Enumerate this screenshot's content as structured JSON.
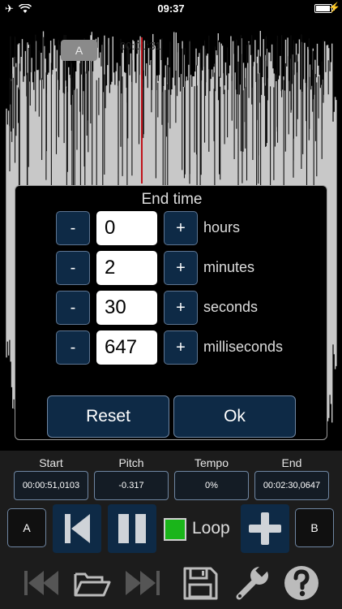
{
  "status_bar": {
    "time": "09:37"
  },
  "waveform": {
    "marker_a_label": "A",
    "playhead_time": "00:01:31"
  },
  "dialog": {
    "title": "End time",
    "minus_label": "-",
    "plus_label": "+",
    "rows": [
      {
        "value": "0",
        "unit": "hours"
      },
      {
        "value": "2",
        "unit": "minutes"
      },
      {
        "value": "30",
        "unit": "seconds"
      },
      {
        "value": "647",
        "unit": "milliseconds"
      }
    ],
    "reset_label": "Reset",
    "ok_label": "Ok"
  },
  "params": {
    "start": {
      "label": "Start",
      "value": "00:00:51,0103"
    },
    "pitch": {
      "label": "Pitch",
      "value": "-0.317"
    },
    "tempo": {
      "label": "Tempo",
      "value": "0%"
    },
    "end": {
      "label": "End",
      "value": "00:02:30,0647"
    }
  },
  "controls": {
    "a_label": "A",
    "b_label": "B",
    "loop_label": "Loop",
    "loop_checked": true,
    "accent_color": "#0e2a46",
    "loop_color": "#1ab51a"
  },
  "toolbar": {
    "icons": [
      "skip-back-icon",
      "folder-open-icon",
      "skip-forward-icon",
      "save-icon",
      "wrench-icon",
      "help-icon"
    ]
  }
}
